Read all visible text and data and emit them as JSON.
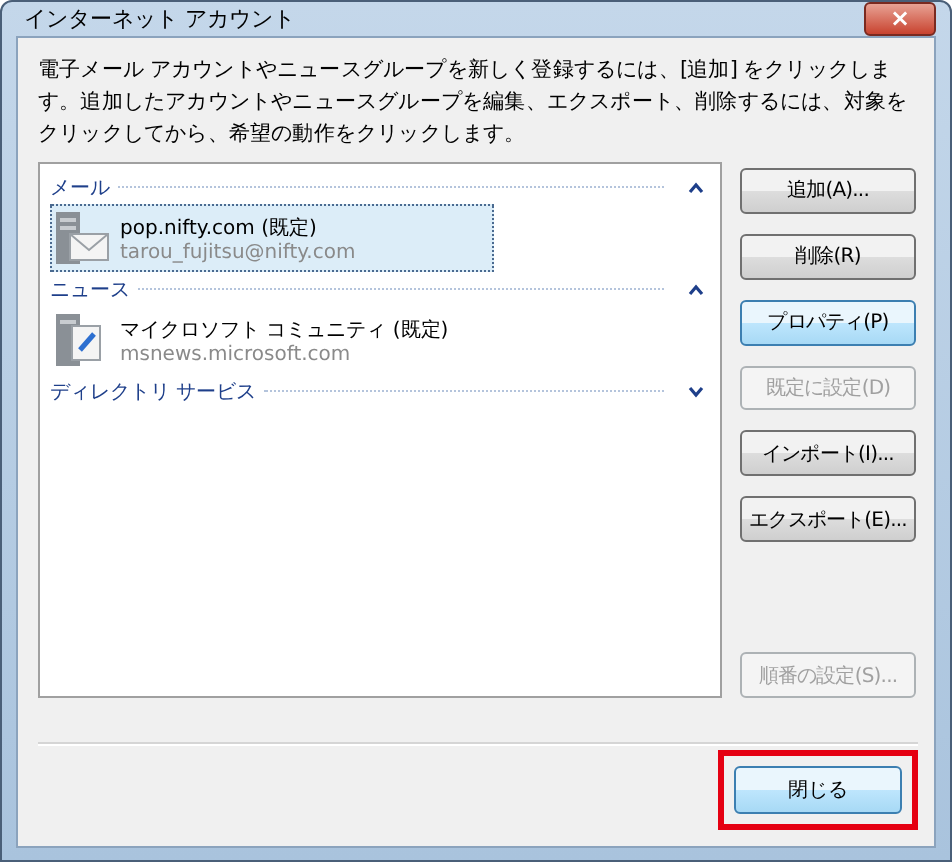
{
  "window": {
    "title": "インターネット アカウント",
    "close": "×"
  },
  "description": "電子メール アカウントやニュースグループを新しく登録するには、[追加] をクリックします。追加したアカウントやニュースグループを編集、エクスポート、削除するには、対象をクリックしてから、希望の動作をクリックします。",
  "groups": [
    {
      "label": "メール",
      "expanded": true,
      "accounts": [
        {
          "kind": "mail",
          "name": "pop.nifty.com (既定)",
          "address": "tarou_fujitsu@nifty.com",
          "selected": true
        }
      ]
    },
    {
      "label": "ニュース",
      "expanded": true,
      "accounts": [
        {
          "kind": "news",
          "name": "マイクロソフト コミュニティ (既定)",
          "address": "msnews.microsoft.com",
          "selected": false
        }
      ]
    },
    {
      "label": "ディレクトリ サービス",
      "expanded": false
    }
  ],
  "buttons": [
    {
      "label": "追加(A)...",
      "disabled": false,
      "focused": false,
      "gap_before": false
    },
    {
      "label": "削除(R)",
      "disabled": false,
      "focused": false,
      "gap_before": false
    },
    {
      "label": "プロパティ(P)",
      "disabled": false,
      "focused": true,
      "gap_before": false
    },
    {
      "label": "既定に設定(D)",
      "disabled": true,
      "focused": false,
      "gap_before": false
    },
    {
      "label": "インポート(I)...",
      "disabled": false,
      "focused": false,
      "gap_before": false
    },
    {
      "label": "エクスポート(E)...",
      "disabled": false,
      "focused": false,
      "gap_before": false
    },
    {
      "label": "順番の設定(S)...",
      "disabled": true,
      "focused": false,
      "gap_before": true
    }
  ],
  "close_button": {
    "label": "閉じる",
    "highlighted": true
  }
}
